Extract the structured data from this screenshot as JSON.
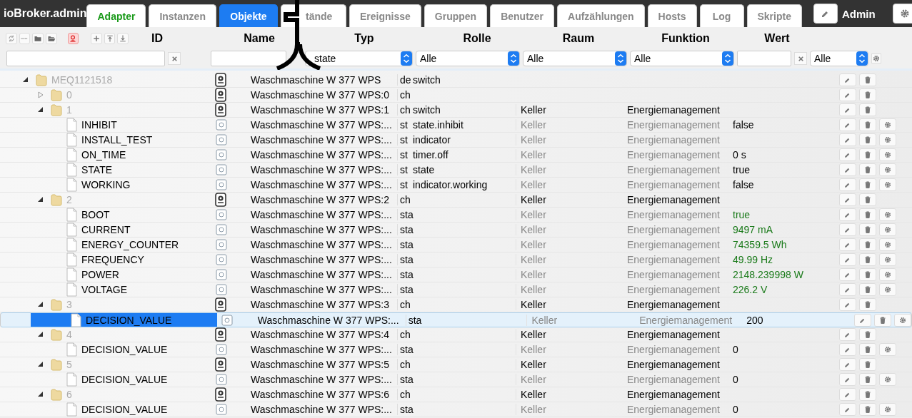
{
  "app": {
    "title": "ioBroker.admin"
  },
  "tabs": [
    {
      "label": "Adapter",
      "selected": false,
      "attention": true
    },
    {
      "label": "Instanzen",
      "selected": false,
      "attention": false
    },
    {
      "label": "Objekte",
      "selected": true,
      "attention": false
    },
    {
      "label": "tände",
      "selected": false,
      "attention": false
    },
    {
      "label": "Ereignisse",
      "selected": false,
      "attention": false
    },
    {
      "label": "Gruppen",
      "selected": false,
      "attention": false
    },
    {
      "label": "Benutzer",
      "selected": false,
      "attention": false
    },
    {
      "label": "Aufzählungen",
      "selected": false,
      "attention": false
    },
    {
      "label": "Hosts",
      "selected": false,
      "attention": false
    },
    {
      "label": "Log",
      "selected": false,
      "attention": false
    },
    {
      "label": "Skripte",
      "selected": false,
      "attention": false
    }
  ],
  "user": {
    "name": "Admin"
  },
  "toolbar": {
    "admin_filter_on": true
  },
  "columns": [
    "ID",
    "Name",
    "Typ",
    "Rolle",
    "Raum",
    "Funktion",
    "Wert"
  ],
  "filters": {
    "typ": "state",
    "rolle": "Alle",
    "raum": "Alle",
    "funktion": "Alle",
    "wert_ack": "Alle"
  },
  "rows": [
    {
      "id": "MEQ1121518",
      "kind": "device",
      "expanded": true,
      "selected": false,
      "name": "Waschmaschine W 377 WPS",
      "type": "de",
      "role": "switch",
      "children": [
        {
          "id": "0",
          "kind": "channel",
          "expanded": false,
          "selected": false,
          "name": "Waschmaschine W 377 WPS:0",
          "type": "ch"
        },
        {
          "id": "1",
          "kind": "channel",
          "expanded": true,
          "selected": false,
          "name": "Waschmaschine W 377 WPS:1",
          "type": "ch",
          "role": "switch",
          "room": "Keller",
          "function": "Energiemanagement",
          "inherited": false,
          "children": [
            {
              "id": "INHIBIT",
              "kind": "state",
              "selected": false,
              "name": "Waschmaschine W 377 WPS:...",
              "type": "st",
              "role": "state.inhibit",
              "room": "Keller",
              "function": "Energiemanagement",
              "inherited": true,
              "value": "false",
              "ack": false
            },
            {
              "id": "INSTALL_TEST",
              "kind": "state",
              "selected": false,
              "name": "Waschmaschine W 377 WPS:...",
              "type": "st",
              "role": "indicator",
              "room": "Keller",
              "function": "Energiemanagement",
              "inherited": true
            },
            {
              "id": "ON_TIME",
              "kind": "state",
              "selected": false,
              "name": "Waschmaschine W 377 WPS:...",
              "type": "st",
              "role": "timer.off",
              "room": "Keller",
              "function": "Energiemanagement",
              "inherited": true,
              "value": "0 s",
              "ack": false
            },
            {
              "id": "STATE",
              "kind": "state",
              "selected": false,
              "name": "Waschmaschine W 377 WPS:...",
              "type": "st",
              "role": "state",
              "room": "Keller",
              "function": "Energiemanagement",
              "inherited": true,
              "value": "true",
              "ack": false
            },
            {
              "id": "WORKING",
              "kind": "state",
              "selected": false,
              "name": "Waschmaschine W 377 WPS:...",
              "type": "st",
              "role": "indicator.working",
              "room": "Keller",
              "function": "Energiemanagement",
              "inherited": true,
              "value": "false",
              "ack": false
            }
          ]
        },
        {
          "id": "2",
          "kind": "channel",
          "expanded": true,
          "selected": false,
          "name": "Waschmaschine W 377 WPS:2",
          "type": "ch",
          "room": "Keller",
          "function": "Energiemanagement",
          "inherited": false,
          "children": [
            {
              "id": "BOOT",
              "kind": "state",
              "selected": false,
              "name": "Waschmaschine W 377 WPS:...",
              "type": "sta",
              "room": "Keller",
              "function": "Energiemanagement",
              "inherited": true,
              "value": "true",
              "ack": true
            },
            {
              "id": "CURRENT",
              "kind": "state",
              "selected": false,
              "name": "Waschmaschine W 377 WPS:...",
              "type": "sta",
              "room": "Keller",
              "function": "Energiemanagement",
              "inherited": true,
              "value": "9497 mA",
              "ack": true
            },
            {
              "id": "ENERGY_COUNTER",
              "kind": "state",
              "selected": false,
              "name": "Waschmaschine W 377 WPS:...",
              "type": "sta",
              "room": "Keller",
              "function": "Energiemanagement",
              "inherited": true,
              "value": "74359.5 Wh",
              "ack": true
            },
            {
              "id": "FREQUENCY",
              "kind": "state",
              "selected": false,
              "name": "Waschmaschine W 377 WPS:...",
              "type": "sta",
              "room": "Keller",
              "function": "Energiemanagement",
              "inherited": true,
              "value": "49.99 Hz",
              "ack": true
            },
            {
              "id": "POWER",
              "kind": "state",
              "selected": false,
              "name": "Waschmaschine W 377 WPS:...",
              "type": "sta",
              "room": "Keller",
              "function": "Energiemanagement",
              "inherited": true,
              "value": "2148.239998 W",
              "ack": true
            },
            {
              "id": "VOLTAGE",
              "kind": "state",
              "selected": false,
              "name": "Waschmaschine W 377 WPS:...",
              "type": "sta",
              "room": "Keller",
              "function": "Energiemanagement",
              "inherited": true,
              "value": "226.2 V",
              "ack": true
            }
          ]
        },
        {
          "id": "3",
          "kind": "channel",
          "expanded": true,
          "selected": false,
          "name": "Waschmaschine W 377 WPS:3",
          "type": "ch",
          "room": "Keller",
          "function": "Energiemanagement",
          "inherited": false,
          "children": [
            {
              "id": "DECISION_VALUE",
              "kind": "state",
              "selected": true,
              "name": "Waschmaschine W 377 WPS:...",
              "type": "sta",
              "room": "Keller",
              "function": "Energiemanagement",
              "inherited": true,
              "value": "200",
              "ack": false
            }
          ]
        },
        {
          "id": "4",
          "kind": "channel",
          "expanded": true,
          "selected": false,
          "name": "Waschmaschine W 377 WPS:4",
          "type": "ch",
          "room": "Keller",
          "function": "Energiemanagement",
          "inherited": false,
          "children": [
            {
              "id": "DECISION_VALUE",
              "kind": "state",
              "selected": false,
              "name": "Waschmaschine W 377 WPS:...",
              "type": "sta",
              "room": "Keller",
              "function": "Energiemanagement",
              "inherited": true,
              "value": "0",
              "ack": false
            }
          ]
        },
        {
          "id": "5",
          "kind": "channel",
          "expanded": true,
          "selected": false,
          "name": "Waschmaschine W 377 WPS:5",
          "type": "ch",
          "room": "Keller",
          "function": "Energiemanagement",
          "inherited": false,
          "children": [
            {
              "id": "DECISION_VALUE",
              "kind": "state",
              "selected": false,
              "name": "Waschmaschine W 377 WPS:...",
              "type": "sta",
              "room": "Keller",
              "function": "Energiemanagement",
              "inherited": true,
              "value": "0",
              "ack": false
            }
          ]
        },
        {
          "id": "6",
          "kind": "channel",
          "expanded": true,
          "selected": false,
          "name": "Waschmaschine W 377 WPS:6",
          "type": "ch",
          "room": "Keller",
          "function": "Energiemanagement",
          "inherited": false,
          "children": [
            {
              "id": "DECISION_VALUE",
              "kind": "state",
              "selected": false,
              "name": "Waschmaschine W 377 WPS:...",
              "type": "sta",
              "room": "Keller",
              "function": "Energiemanagement",
              "inherited": true,
              "value": "0",
              "ack": false
            }
          ]
        }
      ]
    }
  ]
}
